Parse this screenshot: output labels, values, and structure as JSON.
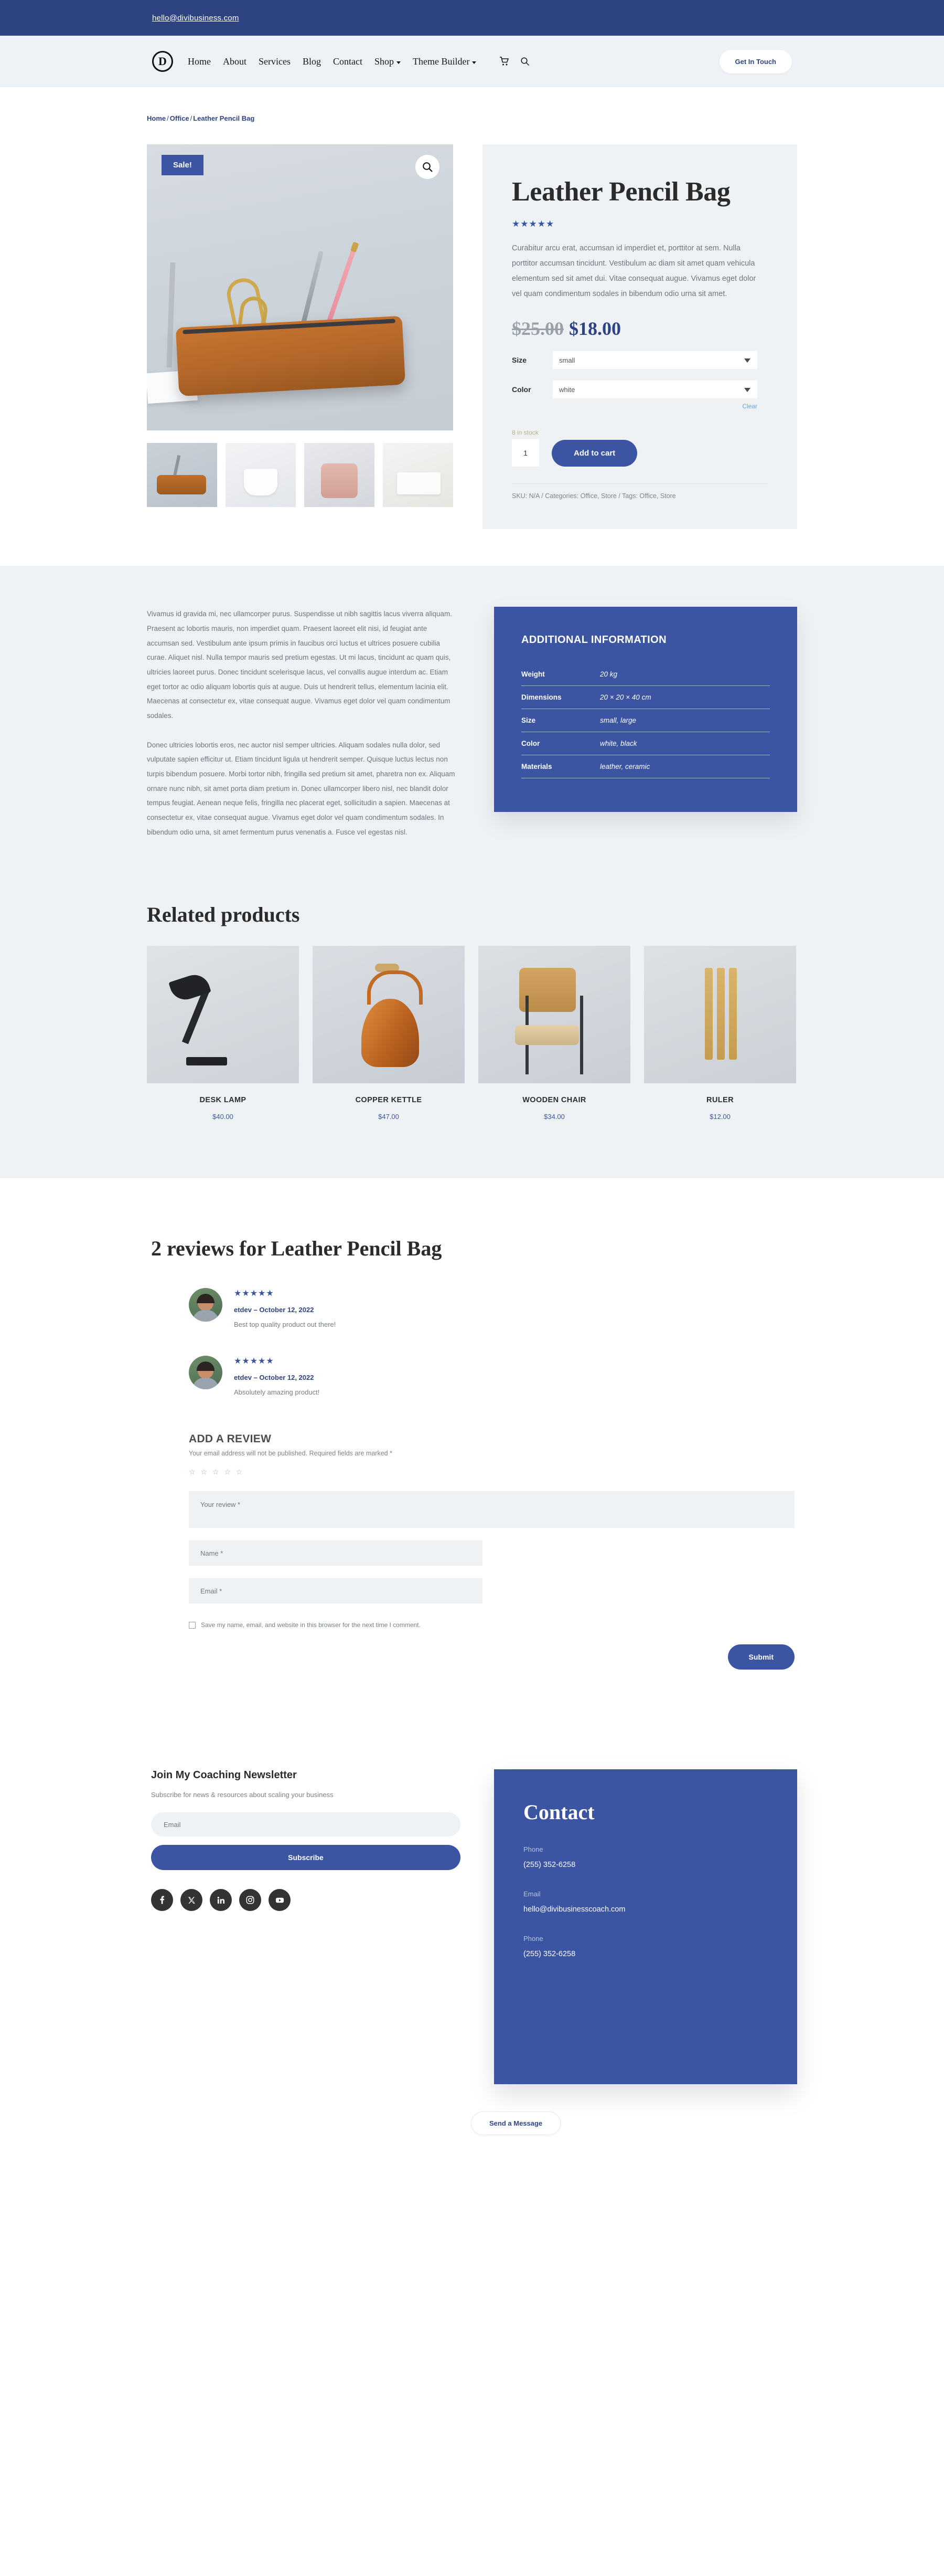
{
  "colors": {
    "navy": "#2E4482",
    "brand_blue": "#3B55A3",
    "page_grey": "#EFF2F5",
    "header_grey": "#EEF1F6"
  },
  "topbar": {
    "email": "hello@divibusiness.com"
  },
  "header": {
    "logo_letter": "D",
    "nav": [
      {
        "label": "Home",
        "has_dropdown": false
      },
      {
        "label": "About",
        "has_dropdown": false
      },
      {
        "label": "Services",
        "has_dropdown": false
      },
      {
        "label": "Blog",
        "has_dropdown": false
      },
      {
        "label": "Contact",
        "has_dropdown": false
      },
      {
        "label": "Shop",
        "has_dropdown": true
      },
      {
        "label": "Theme Builder",
        "has_dropdown": true
      }
    ],
    "icons": [
      "cart-icon",
      "search-icon"
    ],
    "cta_label": "Get In Touch"
  },
  "breadcrumb": {
    "home": "Home",
    "category": "Office",
    "current": "Leather Pencil Bag",
    "separator": "/"
  },
  "product": {
    "sale_badge": "Sale!",
    "zoom_icon": "magnifier-icon",
    "title": "Leather Pencil Bag",
    "rating_stars": "★★★★★",
    "short_description": "Curabitur arcu erat, accumsan id imperdiet et, porttitor at sem. Nulla porttitor accumsan tincidunt. Vestibulum ac diam sit amet quam vehicula elementum sed sit amet dui. Vitae consequat augue. Vivamus eget dolor vel quam condimentum sodales in bibendum odio urna sit amet.",
    "price_old": "$25.00",
    "price_new": "$18.00",
    "variations": [
      {
        "label": "Size",
        "value": "small",
        "options": [
          "small",
          "large"
        ]
      },
      {
        "label": "Color",
        "value": "white",
        "options": [
          "white",
          "black"
        ]
      }
    ],
    "clear_label": "Clear",
    "stock": "8 in stock",
    "quantity": "1",
    "add_to_cart_label": "Add to cart",
    "meta": "SKU: N/A / Categories: Office, Store / Tags: Office, Store",
    "thumbnails": [
      "leather-pencil-bag-thumb",
      "white-pouch-thumb",
      "pink-backpack-thumb",
      "glasses-desk-thumb"
    ]
  },
  "info": {
    "paragraph1": "Vivamus id gravida mi, nec ullamcorper purus. Suspendisse ut nibh sagittis lacus viverra aliquam. Praesent ac lobortis mauris, non imperdiet quam. Praesent laoreet elit nisi, id feugiat ante accumsan sed. Vestibulum ante ipsum primis in faucibus orci luctus et ultrices posuere cubilia curae. Aliquet nisl. Nulla tempor mauris sed pretium egestas. Ut mi lacus, tincidunt ac quam quis, ultricies laoreet purus. Donec tincidunt scelerisque lacus, vel convallis augue interdum ac. Etiam eget tortor ac odio aliquam lobortis quis at augue. Duis ut hendrerit tellus, elementum lacinia elit. Maecenas at consectetur ex, vitae consequat augue. Vivamus eget dolor vel quam condimentum sodales.",
    "paragraph2": "Donec ultricies lobortis eros, nec auctor nisl semper ultricies. Aliquam sodales nulla dolor, sed vulputate sapien efficitur ut. Etiam tincidunt ligula ut hendrerit semper. Quisque luctus lectus non turpis bibendum posuere. Morbi tortor nibh, fringilla sed pretium sit amet, pharetra non ex. Aliquam ornare nunc nibh, sit amet porta diam pretium in. Donec ullamcorper libero nisl, nec blandit dolor tempus feugiat. Aenean neque felis, fringilla nec placerat eget, sollicitudin a sapien. Maecenas at consectetur ex, vitae consequat augue. Vivamus eget dolor vel quam condimentum sodales. In bibendum odio urna, sit amet fermentum purus venenatis a. Fusce vel egestas nisl.",
    "additional_title": "ADDITIONAL INFORMATION",
    "additional_rows": [
      {
        "key": "Weight",
        "value": "20 kg"
      },
      {
        "key": "Dimensions",
        "value": "20 × 20 × 40 cm"
      },
      {
        "key": "Size",
        "value": "small, large"
      },
      {
        "key": "Color",
        "value": "white, black"
      },
      {
        "key": "Materials",
        "value": "leather, ceramic"
      }
    ]
  },
  "related": {
    "title": "Related products",
    "items": [
      {
        "name": "DESK LAMP",
        "price": "$40.00",
        "image": "desk-lamp-image"
      },
      {
        "name": "COPPER KETTLE",
        "price": "$47.00",
        "image": "copper-kettle-image"
      },
      {
        "name": "WOODEN CHAIR",
        "price": "$34.00",
        "image": "wooden-chair-image"
      },
      {
        "name": "RULER",
        "price": "$12.00",
        "image": "ruler-image"
      }
    ]
  },
  "reviews": {
    "title": "2 reviews for Leather Pencil Bag",
    "items": [
      {
        "stars": "★★★★★",
        "meta": "etdev – October 12, 2022",
        "text": "Best top quality product out there!"
      },
      {
        "stars": "★★★★★",
        "meta": "etdev – October 12, 2022",
        "text": "Absolutely amazing product!"
      }
    ]
  },
  "add_review": {
    "heading": "ADD A REVIEW",
    "note": "Your email address will not be published. Required fields are marked *",
    "rating_placeholder": "☆ ☆ ☆ ☆ ☆",
    "review_placeholder": "Your review *",
    "name_placeholder": "Name *",
    "email_placeholder": "Email *",
    "save_label": "Save my name, email, and website in this browser for the next time I comment.",
    "submit_label": "Submit"
  },
  "newsletter": {
    "title": "Join My Coaching Newsletter",
    "subtitle": "Subscribe for news & resources about scaling your business",
    "email_placeholder": "Email",
    "button_label": "Subscribe",
    "socials": [
      "facebook-icon",
      "x-twitter-icon",
      "linkedin-icon",
      "instagram-icon",
      "youtube-icon"
    ]
  },
  "contact": {
    "title": "Contact",
    "rows": [
      {
        "label": "Phone",
        "value": "(255) 352-6258"
      },
      {
        "label": "Email",
        "value": "hello@divibusinesscoach.com"
      },
      {
        "label": "Phone",
        "value": "(255) 352-6258"
      }
    ],
    "send_label": "Send a Message"
  }
}
